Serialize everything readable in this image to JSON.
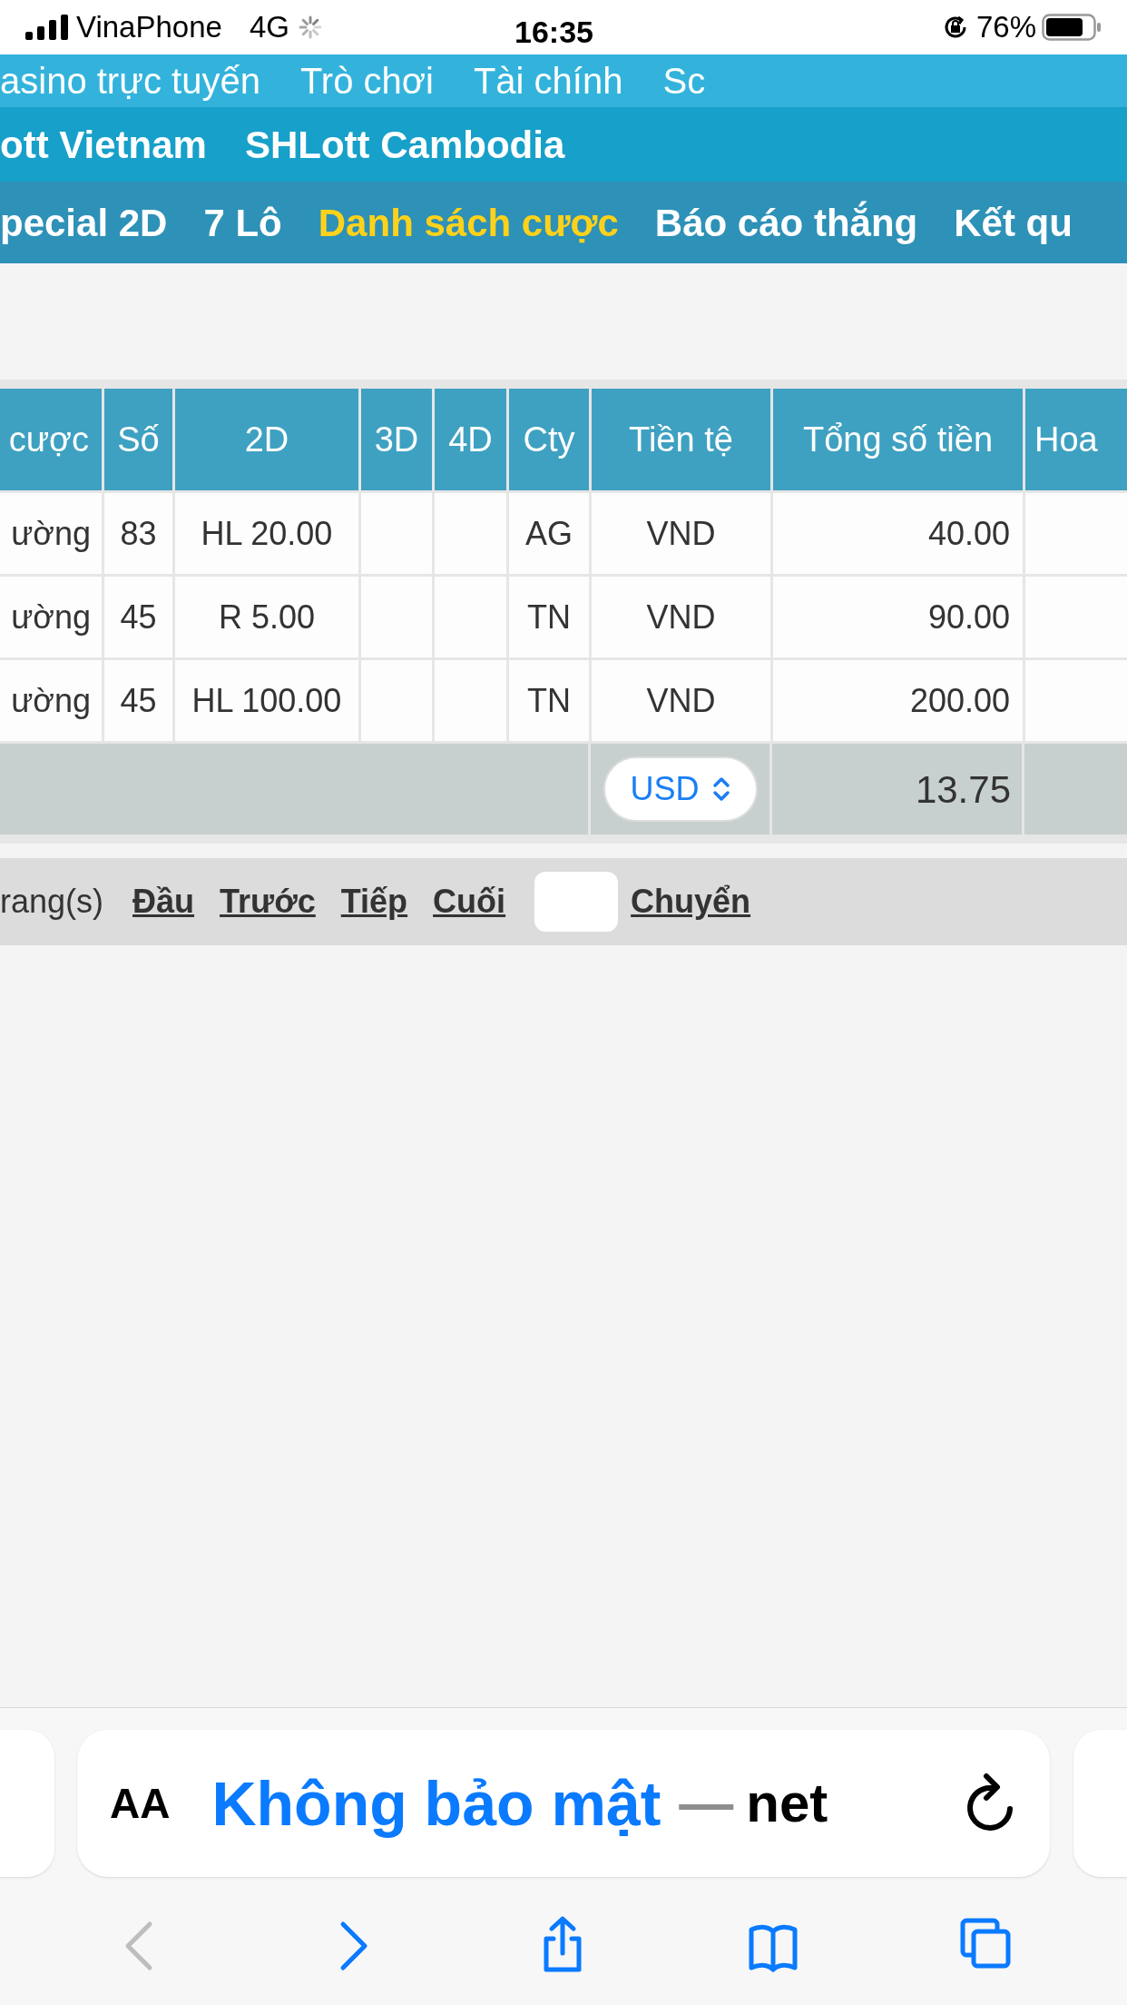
{
  "status_bar": {
    "carrier": "VinaPhone",
    "network": "4G",
    "time": "16:35",
    "battery": "76%"
  },
  "top_menu": [
    "asino trực tuyến",
    "Trò chơi",
    "Tài chính",
    "Sc"
  ],
  "sub_menu": [
    "ott Vietnam",
    "SHLott Cambodia"
  ],
  "section_menu": [
    {
      "label": "pecial 2D",
      "selected": false
    },
    {
      "label": "7 Lô",
      "selected": false
    },
    {
      "label": "Danh sách cược",
      "selected": true
    },
    {
      "label": "Báo cáo thắng",
      "selected": false
    },
    {
      "label": "Kết qu",
      "selected": false
    }
  ],
  "table": {
    "columns": [
      "cược",
      "Số",
      "2D",
      "3D",
      "4D",
      "Cty",
      "Tiền tệ",
      "Tổng số tiền",
      "Hoa"
    ],
    "rows": [
      {
        "column_1": "ường",
        "number": "83",
        "2d": "HL 20.00",
        "cty": "AG",
        "currency": "VND",
        "total": "40.00"
      },
      {
        "column_1": "ường",
        "number": "45",
        "2d": "R 5.00",
        "cty": "TN",
        "currency": "VND",
        "total": "90.00"
      },
      {
        "column_1": "ường",
        "number": "45",
        "2d": "HL 100.00",
        "cty": "TN",
        "currency": "VND",
        "total": "200.00"
      }
    ],
    "footer": {
      "currency_select": "USD",
      "total": "13.75"
    }
  },
  "pagination": {
    "label": "rang(s)",
    "links": [
      "Đầu",
      "Trước",
      "Tiếp",
      "Cuối"
    ],
    "go": "Chuyển"
  },
  "browser": {
    "text_size": "AA",
    "security": "Không bảo mật",
    "separator": "—",
    "domain": "net",
    "toolbar": [
      {
        "kind": "back",
        "disabled": true
      },
      {
        "kind": "forward",
        "disabled": false
      },
      {
        "kind": "share",
        "disabled": false
      },
      {
        "kind": "bookmarks",
        "disabled": false
      },
      {
        "kind": "tabs",
        "disabled": false
      }
    ]
  }
}
